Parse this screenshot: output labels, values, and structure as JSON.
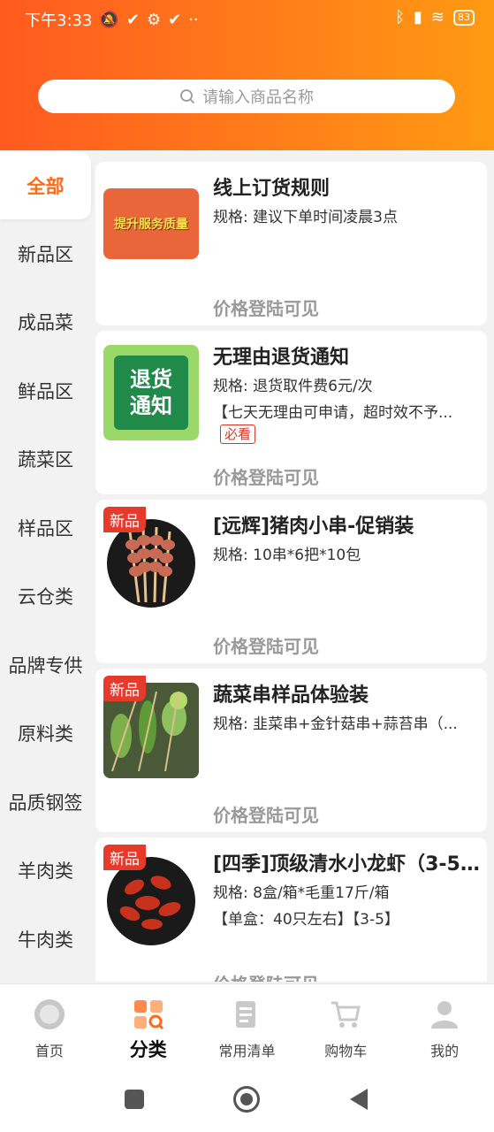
{
  "status": {
    "time": "下午3:33",
    "battery": "83"
  },
  "search": {
    "placeholder": "请输入商品名称"
  },
  "sidebar": {
    "items": [
      {
        "label": "全部",
        "active": true
      },
      {
        "label": "新品区"
      },
      {
        "label": "成品菜"
      },
      {
        "label": "鲜品区"
      },
      {
        "label": "蔬菜区"
      },
      {
        "label": "样品区"
      },
      {
        "label": "云仓类"
      },
      {
        "label": "品牌专供"
      },
      {
        "label": "原料类"
      },
      {
        "label": "品质钢签"
      },
      {
        "label": "羊肉类"
      },
      {
        "label": "牛肉类"
      }
    ]
  },
  "products": [
    {
      "title": "线上订货规则",
      "spec": "规格: 建议下单时间凌晨3点",
      "price": "价格登陆可见",
      "image_text": "提升服务质量"
    },
    {
      "title": "无理由退货通知",
      "spec": "规格: 退货取件费6元/次",
      "desc": "【七天无理由可申请，超时效不予...",
      "tag": "必看",
      "price": "价格登陆可见",
      "image_text": "退货通知"
    },
    {
      "title": "[远辉]猪肉小串-促销装",
      "spec": "规格: 10串*6把*10包",
      "badge": "新品",
      "price": "价格登陆可见"
    },
    {
      "title": "蔬菜串样品体验装",
      "spec": "规格: 韭菜串+金针菇串+蒜苔串（...",
      "badge": "新品",
      "price": "价格登陆可见"
    },
    {
      "title": "[四季]顶级清水小龙虾（3-5...",
      "spec": "规格: 8盒/箱*毛重17斤/箱",
      "desc": "【单盒：40只左右】【3-5】",
      "badge": "新品",
      "price": "价格登陆可见"
    }
  ],
  "bottom_nav": [
    {
      "label": "首页",
      "icon": "home-icon"
    },
    {
      "label": "分类",
      "icon": "category-icon",
      "active": true
    },
    {
      "label": "常用清单",
      "icon": "list-icon"
    },
    {
      "label": "购物车",
      "icon": "cart-icon"
    },
    {
      "label": "我的",
      "icon": "user-icon"
    }
  ],
  "colors": {
    "accent": "#ff6a1a",
    "new_badge": "#e63a2a",
    "price_gray": "#999999"
  }
}
